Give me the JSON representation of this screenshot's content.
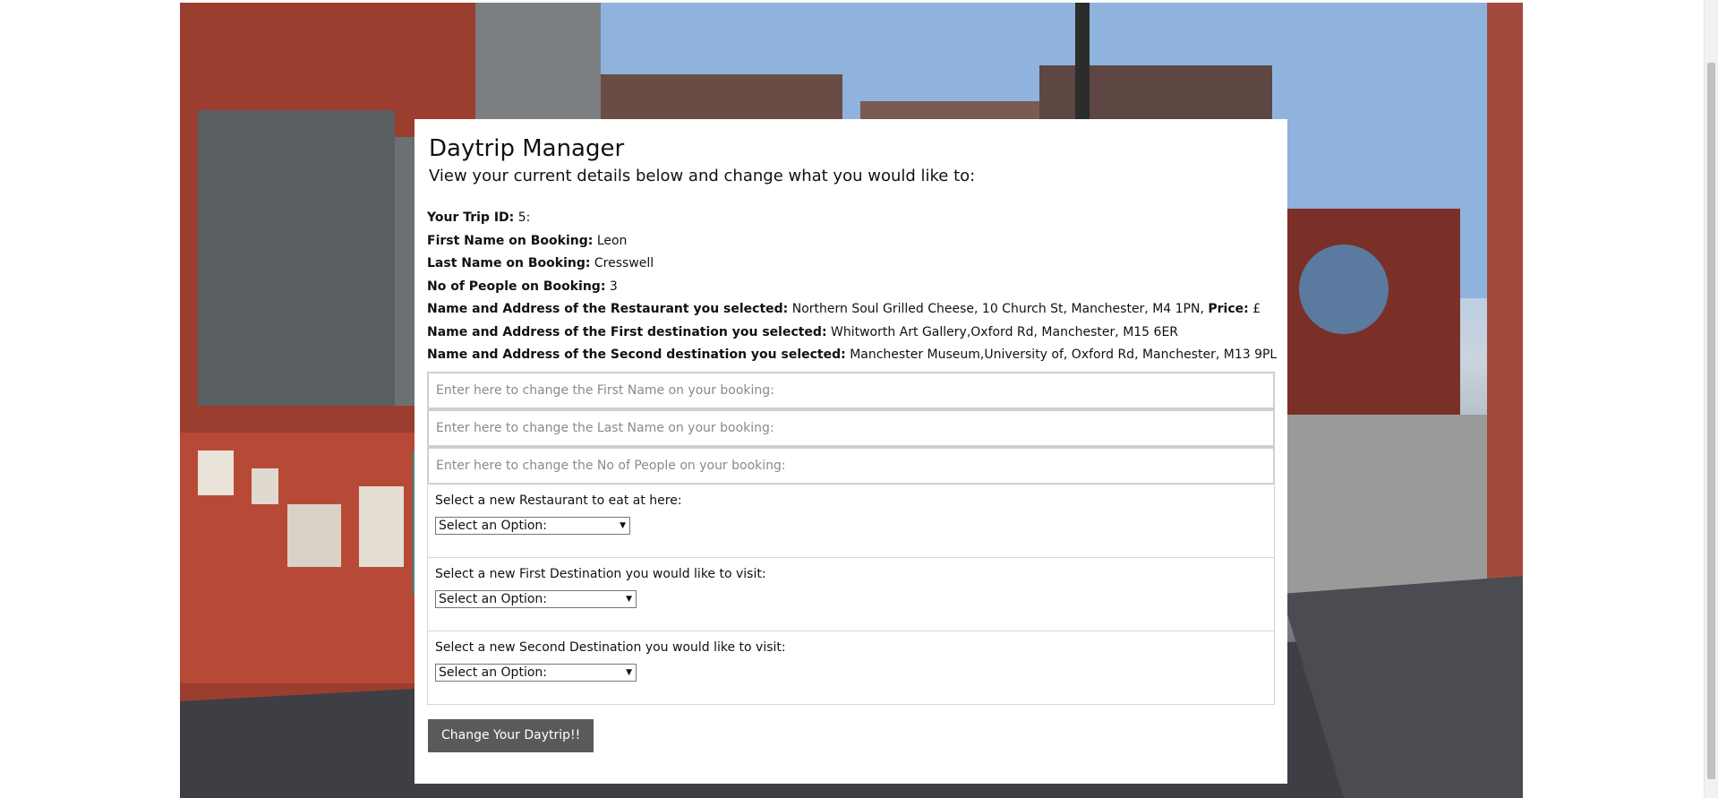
{
  "page": {
    "title": "Daytrip Manager",
    "subtitle": "View your current details below and change what you would like to:"
  },
  "details": {
    "trip_id_label": "Your Trip ID:",
    "trip_id_value": "5:",
    "first_name_label": "First Name on Booking:",
    "first_name_value": "Leon",
    "last_name_label": "Last Name on Booking:",
    "last_name_value": "Cresswell",
    "people_label": "No of People on Booking:",
    "people_value": "3",
    "restaurant_label": "Name and Address of the Restaurant you selected:",
    "restaurant_value": "Northern Soul Grilled Cheese, 10 Church St, Manchester, M4 1PN,",
    "price_label": "Price:",
    "price_value": "£",
    "first_dest_label": "Name and Address of the First destination you selected:",
    "first_dest_value": "Whitworth Art Gallery,Oxford Rd, Manchester, M15 6ER",
    "second_dest_label": "Name and Address of the Second destination you selected:",
    "second_dest_value": "Manchester Museum,University of, Oxford Rd, Manchester, M13 9PL"
  },
  "form": {
    "first_name_placeholder": "Enter here to change the First Name on your booking:",
    "last_name_placeholder": "Enter here to change the Last Name on your booking:",
    "people_placeholder": "Enter here to change the No of People on your booking:",
    "restaurant_label": "Select a new Restaurant to eat at here:",
    "restaurant_selected": "Select an Option:",
    "first_dest_label": "Select a new First Destination you would like to visit:",
    "first_dest_selected": "Select an Option:",
    "second_dest_label": "Select a new Second Destination you would like to visit:",
    "second_dest_selected": "Select an Option:",
    "submit_label": "Change Your Daytrip!!",
    "dropdown_arrow": "▼"
  },
  "colors": {
    "button_bg": "#5a5a5a",
    "card_bg": "#ffffff",
    "input_border": "#cfcfcf"
  },
  "icons": {
    "dropdown": "chevron-down-icon"
  }
}
